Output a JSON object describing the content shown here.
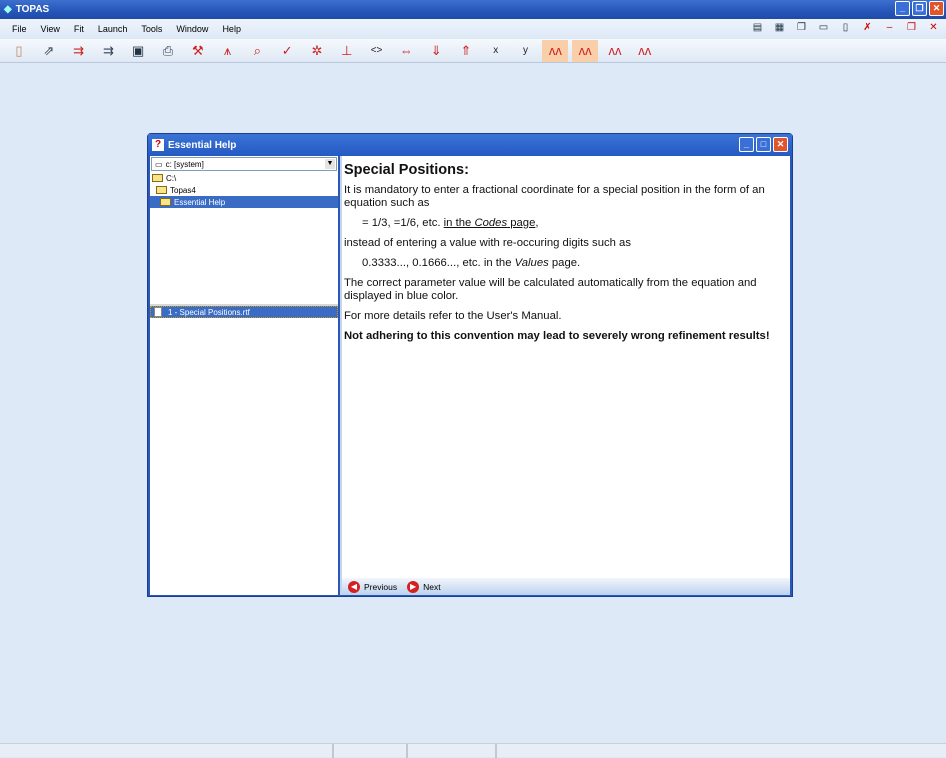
{
  "app": {
    "title": "TOPAS"
  },
  "menu": [
    "File",
    "View",
    "Fit",
    "Launch",
    "Tools",
    "Window",
    "Help"
  ],
  "toolbar": {
    "icons": [
      "new-file",
      "open-file",
      "import",
      "export",
      "save",
      "print",
      "wrench",
      "peak-insert",
      "peak-search",
      "check",
      "peak-fit",
      "peak-bar",
      "code-brackets",
      "zoom-range",
      "peak-down",
      "peak-up",
      "x",
      "y",
      "pattern-active",
      "pattern-difference",
      "pattern-background",
      "pattern-plain"
    ],
    "text_buttons": {
      "x": "x",
      "y": "y"
    }
  },
  "dialog": {
    "title": "Essential Help",
    "drive": "c: [system]",
    "tree": [
      "C:\\",
      "Topas4",
      "Essential Help"
    ],
    "files": [
      "1 - Special Positions.rtf"
    ],
    "content": {
      "heading": "Special Positions:",
      "p1": "It is mandatory to enter a fractional coordinate for a special position in the form of an equation such as",
      "eq": "= 1/3, =1/6, etc.",
      "eq_link_a": "in the ",
      "eq_link_em": "Codes",
      "eq_link_b": " page",
      "eq_end": ",",
      "p2": "instead of entering a value with re-occuring digits such as",
      "vals": "0.3333..., 0.1666..., etc. in the ",
      "vals_em": "Values",
      "vals_end": " page.",
      "p3": "The correct parameter value will be calculated automatically from the equation and displayed in blue color.",
      "p4": "For more details refer to the User's Manual.",
      "warning": "Not adhering to this convention may lead to severely wrong refinement results!"
    },
    "nav": {
      "previous": "Previous",
      "next": "Next"
    }
  }
}
